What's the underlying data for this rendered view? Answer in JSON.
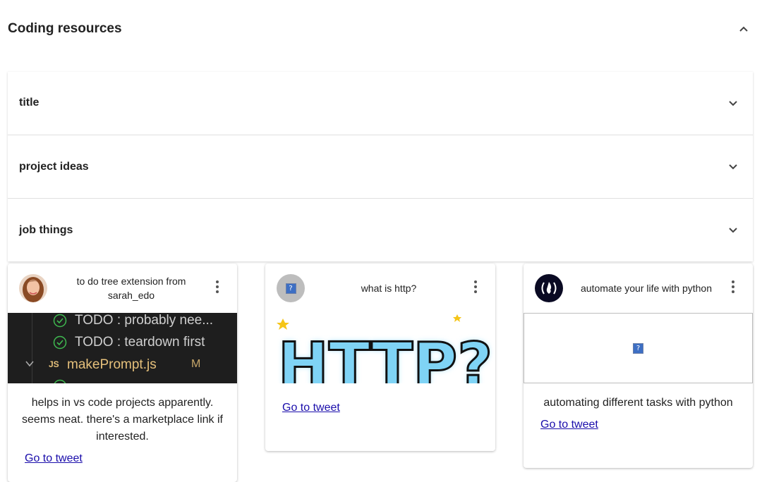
{
  "section": {
    "title": "Coding resources",
    "collapse_icon": "chevron-up-icon"
  },
  "accordion": {
    "items": [
      {
        "label": "title",
        "icon": "chevron-down-icon"
      },
      {
        "label": "project ideas",
        "icon": "chevron-down-icon"
      },
      {
        "label": "job things",
        "icon": "chevron-down-icon"
      }
    ]
  },
  "cards": [
    {
      "title": "to do tree extension from sarah_edo",
      "avatar": "user-photo-avatar",
      "code_lines": [
        "TODO : probably nee...",
        "TODO : teardown first",
        "makePrompt.js",
        "M"
      ],
      "code_file_badge": "JS",
      "description": "helps in vs code projects apparently. seems neat. there's a marketplace link if interested.",
      "link": "Go to tweet"
    },
    {
      "title": "what is http?",
      "avatar": "broken-image-avatar",
      "media_text": "HTTP?",
      "link": "Go to tweet"
    },
    {
      "title": "automate your life with python",
      "avatar": "freecodecamp-logo-avatar",
      "description": "automating different tasks with python",
      "link": "Go to tweet"
    }
  ],
  "broken_image_glyph": "?",
  "colors": {
    "link": "#1a0dab",
    "code_bg": "#1e1e1e",
    "check": "#3fb950",
    "http_fill": "#7fd3f5"
  }
}
